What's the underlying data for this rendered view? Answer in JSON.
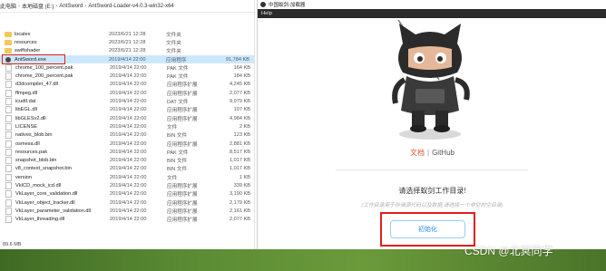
{
  "explorer": {
    "breadcrumb": [
      "此电脑",
      "本地磁盘 (E:)",
      "AntSword",
      "AntSword-Loader-v4.0.3-win32-x64"
    ],
    "files": [
      {
        "name": "locales",
        "date": "2023/6/21 12:28",
        "type": "文件夹",
        "size": "",
        "kind": "folder"
      },
      {
        "name": "resources",
        "date": "2023/6/21 12:28",
        "type": "文件夹",
        "size": "",
        "kind": "folder"
      },
      {
        "name": "swiftshader",
        "date": "2023/6/21 12:28",
        "type": "文件夹",
        "size": "",
        "kind": "folder"
      },
      {
        "name": "AntSword.exe",
        "date": "2019/4/14 22:00",
        "type": "应用程序",
        "size": "91,784 KB",
        "kind": "exe"
      },
      {
        "name": "chrome_100_percent.pak",
        "date": "2019/4/14 22:00",
        "type": "PAK 文件",
        "size": "164 KB",
        "kind": "file"
      },
      {
        "name": "chrome_200_percent.pak",
        "date": "2019/4/14 22:00",
        "type": "PAK 文件",
        "size": "184 KB",
        "kind": "file"
      },
      {
        "name": "d3dcompiler_47.dll",
        "date": "2019/4/14 22:00",
        "type": "应用程序扩展",
        "size": "4,245 KB",
        "kind": "file"
      },
      {
        "name": "ffmpeg.dll",
        "date": "2019/4/14 22:00",
        "type": "应用程序扩展",
        "size": "2,077 KB",
        "kind": "file"
      },
      {
        "name": "icudtl.dat",
        "date": "2019/4/14 22:00",
        "type": "DAT 文件",
        "size": "9,979 KB",
        "kind": "file"
      },
      {
        "name": "libEGL.dll",
        "date": "2019/4/14 22:00",
        "type": "应用程序扩展",
        "size": "107 KB",
        "kind": "file"
      },
      {
        "name": "libGLESv2.dll",
        "date": "2019/4/14 22:00",
        "type": "应用程序扩展",
        "size": "4,984 KB",
        "kind": "file"
      },
      {
        "name": "LICENSE",
        "date": "2019/4/14 22:00",
        "type": "文件",
        "size": "2 KB",
        "kind": "file"
      },
      {
        "name": "natives_blob.bin",
        "date": "2019/4/14 22:00",
        "type": "BIN 文件",
        "size": "123 KB",
        "kind": "file"
      },
      {
        "name": "osmesa.dll",
        "date": "2019/4/14 22:00",
        "type": "应用程序扩展",
        "size": "2,881 KB",
        "kind": "file"
      },
      {
        "name": "resources.pak",
        "date": "2019/4/14 22:00",
        "type": "PAK 文件",
        "size": "8,517 KB",
        "kind": "file"
      },
      {
        "name": "snapshot_blob.bin",
        "date": "2019/4/14 22:00",
        "type": "BIN 文件",
        "size": "1,017 KB",
        "kind": "file"
      },
      {
        "name": "v8_context_snapshot.bin",
        "date": "2019/4/14 22:00",
        "type": "BIN 文件",
        "size": "1,017 KB",
        "kind": "file"
      },
      {
        "name": "version",
        "date": "2019/4/14 22:00",
        "type": "文件",
        "size": "1 KB",
        "kind": "file"
      },
      {
        "name": "VkICD_mock_icd.dll",
        "date": "2019/4/14 22:00",
        "type": "应用程序扩展",
        "size": "339 KB",
        "kind": "file"
      },
      {
        "name": "VkLayer_core_validation.dll",
        "date": "2019/4/14 22:00",
        "type": "应用程序扩展",
        "size": "3,190 KB",
        "kind": "file"
      },
      {
        "name": "VkLayer_object_tracker.dll",
        "date": "2019/4/14 22:00",
        "type": "应用程序扩展",
        "size": "2,179 KB",
        "kind": "file"
      },
      {
        "name": "VkLayer_parameter_validation.dll",
        "date": "2019/4/14 22:00",
        "type": "应用程序扩展",
        "size": "2,161 KB",
        "kind": "file"
      },
      {
        "name": "VkLayer_threading.dll",
        "date": "2019/4/14 22:00",
        "type": "应用程序扩展",
        "size": "2,077 KB",
        "kind": "file"
      }
    ],
    "status": "89.6 MB"
  },
  "app": {
    "title": "中国蚁剑-加载器",
    "menu_help": "Help",
    "link_docs": "文档",
    "link_sep": "|",
    "link_github": "GitHub",
    "prompt": "请选择蚁剑工作目录!",
    "subtitle": "(工作目录用于存储源代码以及数据,请选择一个非空的空目录)",
    "init_button": "初始化"
  },
  "watermark": "CSDN @北冥同学",
  "colors": {
    "highlight_red": "#e0201b",
    "link_orange": "#e0582b",
    "button_blue": "#2d8cf0",
    "menubar": "#2b2b2b",
    "selected_row": "#cce8ff"
  }
}
